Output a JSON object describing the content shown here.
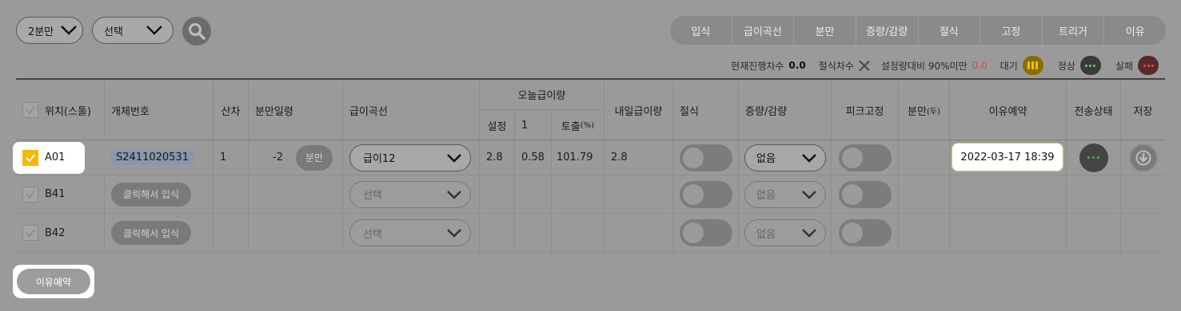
{
  "toolbar": {
    "period_select": "2분만",
    "filter_select": "선택"
  },
  "tabs": [
    "입식",
    "급이곡선",
    "분만",
    "증량/감량",
    "절식",
    "고정",
    "트리거",
    "이유"
  ],
  "status": {
    "current_label": "현재진행차수",
    "current_value": "0.0",
    "fasting_label": "절식차수",
    "setting_label": "설정량대비 90%미만",
    "setting_value": "0.0",
    "wait_label": "대기",
    "normal_label": "정상",
    "fail_label": "실패"
  },
  "table": {
    "headers": {
      "position": "위치(스톨)",
      "id": "개체번호",
      "parity": "산차",
      "days": "분만일령",
      "curve": "급이곡선",
      "today": "오늘급이량",
      "today_set": "설정",
      "today_1": "1",
      "today_out": "토출",
      "today_out_unit": "(%)",
      "tomorrow": "내일급이량",
      "fasting": "절식",
      "adjust": "증량/감량",
      "peak_fix": "피크고정",
      "farrow": "분만",
      "farrow_unit": "(두)",
      "weaning": "이유예약",
      "send": "전송상태",
      "save": "저장"
    },
    "rows": [
      {
        "position": "A01",
        "checked": true,
        "id": "S2411020531",
        "parity": "1",
        "days": "-2",
        "farrow_btn": "분만",
        "curve": "급이12",
        "set": "2.8",
        "v1": "0.58",
        "out": "101.79",
        "tomorrow": "2.8",
        "adjust": "없음",
        "weaning": "2022-03-17 18:39"
      },
      {
        "position": "B41",
        "checked": false,
        "entry_btn": "클릭해서 입식",
        "curve": "선택",
        "adjust": "없음"
      },
      {
        "position": "B42",
        "checked": false,
        "entry_btn": "클릭해서 입식",
        "curve": "선택",
        "adjust": "없음"
      }
    ]
  },
  "bottom": {
    "weaning_button": "이유예약"
  }
}
